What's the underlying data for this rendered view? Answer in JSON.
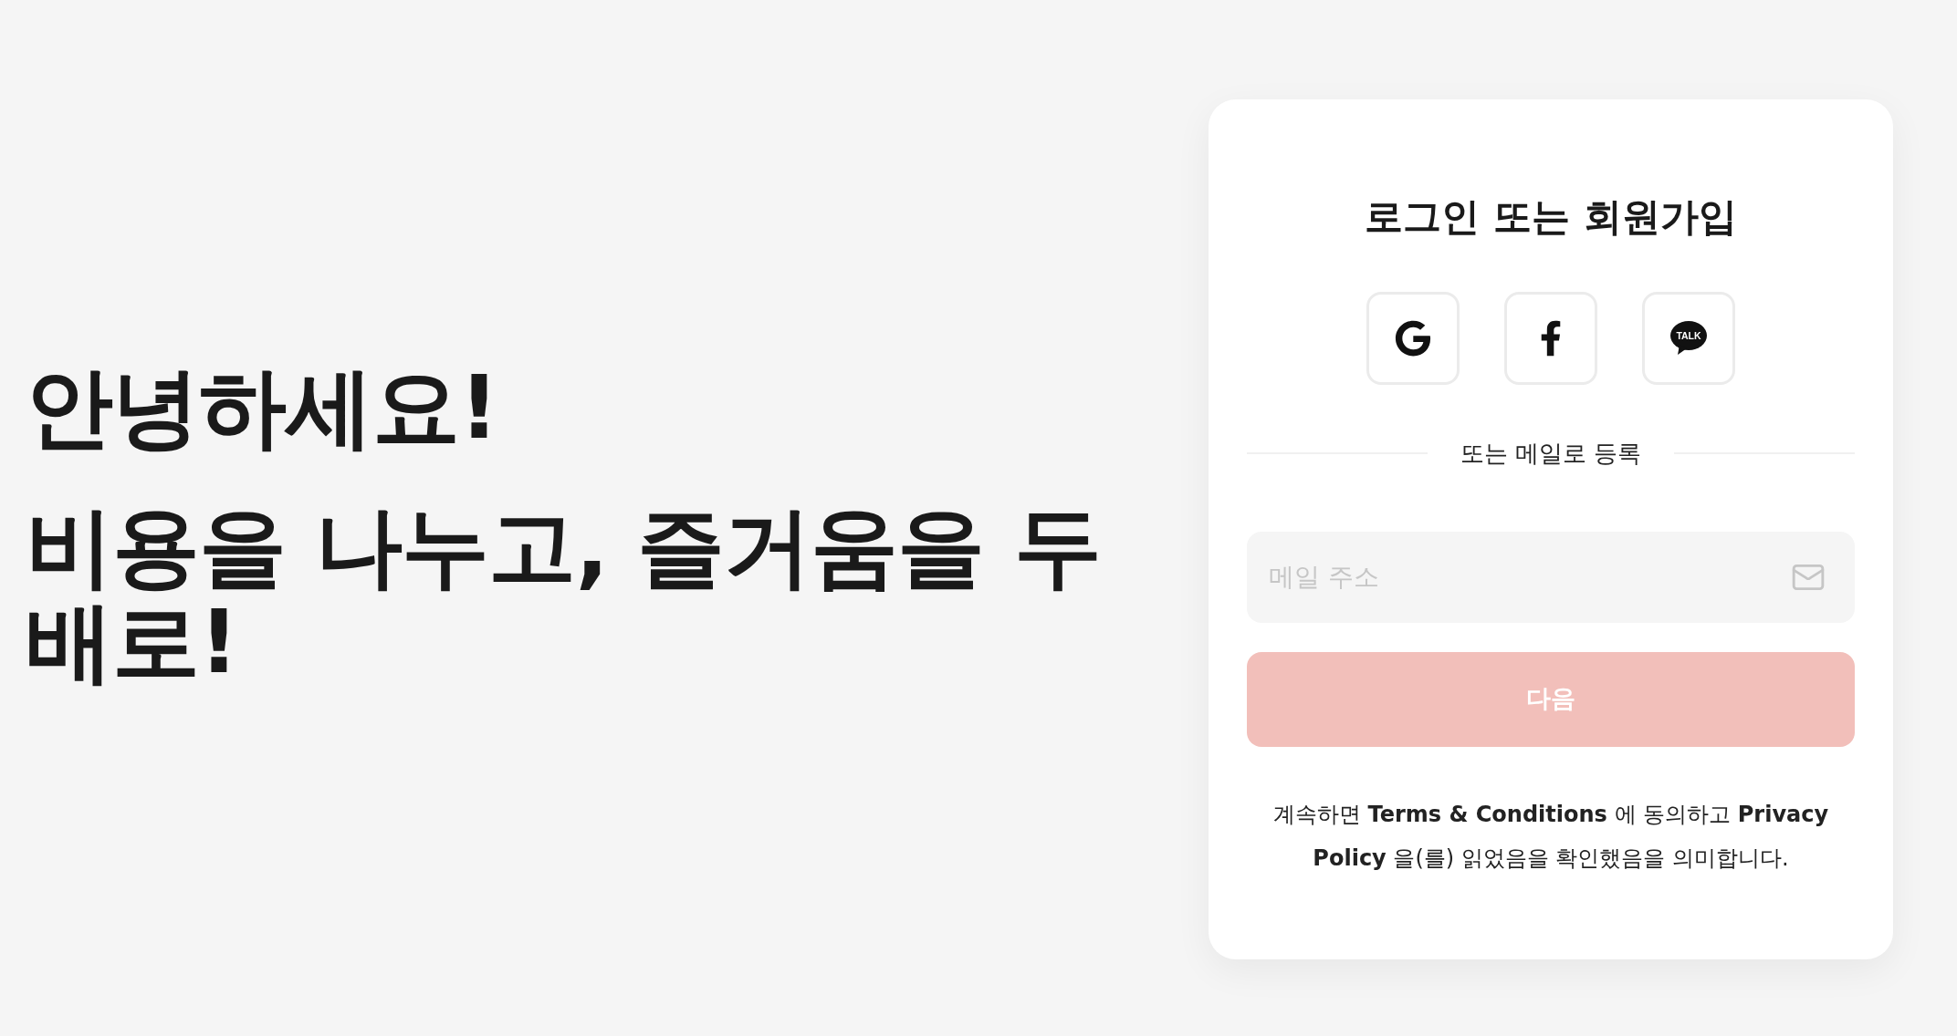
{
  "hero": {
    "greeting": "안녕하세요!",
    "tagline": "비용을 나누고, 즐거움을 두 배로!"
  },
  "login_card": {
    "title": "로그인 또는 회원가입",
    "social_buttons": [
      {
        "kind": "google"
      },
      {
        "kind": "facebook"
      },
      {
        "kind": "kakao",
        "label": "TALK"
      }
    ],
    "divider_text": "또는 메일로 등록",
    "email_field": {
      "placeholder": "메일 주소"
    },
    "next_button": {
      "label": "다음",
      "disabled": true
    },
    "terms": "계속하면 **Terms & Conditions** 에 동의하고 **Privacy Policy** 을(를) 읽었음을 확인했음을 의미합니다."
  }
}
